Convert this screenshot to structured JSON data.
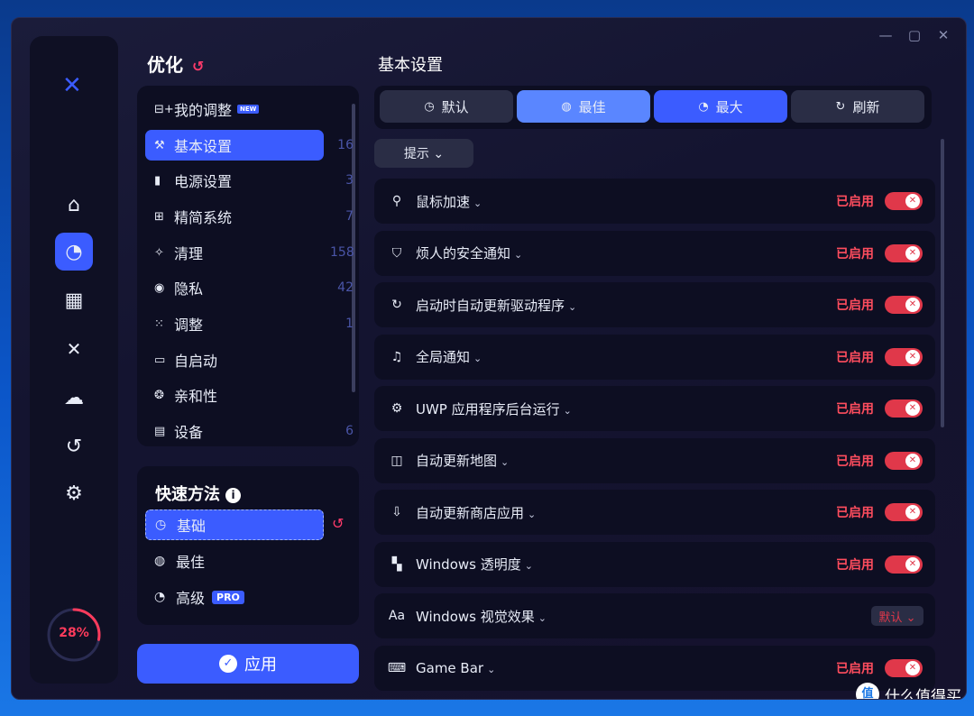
{
  "window_controls": {
    "minimize": "—",
    "maximize": "▢",
    "close": "✕"
  },
  "sidebar": {
    "logo": "✕",
    "nav": [
      {
        "name": "home-icon",
        "glyph": "⌂"
      },
      {
        "name": "speed-gauge-icon",
        "glyph": "◔"
      },
      {
        "name": "apps-grid-icon",
        "glyph": "▦"
      },
      {
        "name": "connections-icon",
        "glyph": "✕"
      },
      {
        "name": "cloud-upload-icon",
        "glyph": "☁"
      },
      {
        "name": "restore-icon",
        "glyph": "↺"
      },
      {
        "name": "settings-gear-icon",
        "glyph": "⚙"
      }
    ],
    "progress_value": 28,
    "progress_text": "28%"
  },
  "left": {
    "title": "优化",
    "reset_glyph": "↺",
    "categories": [
      {
        "icon": "⊟+",
        "label": "我的调整",
        "badge": "NEW",
        "count": ""
      },
      {
        "icon": "⚒",
        "label": "基本设置",
        "badge": "",
        "count": "16"
      },
      {
        "icon": "▮",
        "label": "电源设置",
        "badge": "",
        "count": "3"
      },
      {
        "icon": "⊞",
        "label": "精简系统",
        "badge": "",
        "count": "7"
      },
      {
        "icon": "✧",
        "label": "清理",
        "badge": "",
        "count": "158"
      },
      {
        "icon": "◉",
        "label": "隐私",
        "badge": "",
        "count": "42"
      },
      {
        "icon": "⁙",
        "label": "调整",
        "badge": "",
        "count": "1"
      },
      {
        "icon": "▭",
        "label": "自启动",
        "badge": "",
        "count": ""
      },
      {
        "icon": "❂",
        "label": "亲和性",
        "badge": "",
        "count": ""
      },
      {
        "icon": "▤",
        "label": "设备",
        "badge": "",
        "count": "6"
      }
    ],
    "quick": {
      "title": "快速方法",
      "info_glyph": "i",
      "items": [
        {
          "icon": "◷",
          "label": "基础",
          "badge": ""
        },
        {
          "icon": "◍",
          "label": "最佳",
          "badge": ""
        },
        {
          "icon": "◔",
          "label": "高级",
          "badge": "PRO"
        }
      ],
      "reset_glyph": "↺"
    },
    "apply_label": "应用",
    "apply_glyph": "✓"
  },
  "main": {
    "title": "基本设置",
    "presets": [
      {
        "icon": "◷",
        "label": "默认"
      },
      {
        "icon": "◍",
        "label": "最佳"
      },
      {
        "icon": "◔",
        "label": "最大"
      },
      {
        "icon": "↻",
        "label": "刷新"
      }
    ],
    "tip_label": "提示 ⌄",
    "rows": [
      {
        "icon": "⚲",
        "label": "鼠标加速",
        "status": "已启用",
        "toggle": "✕"
      },
      {
        "icon": "⛉",
        "label": "烦人的安全通知",
        "status": "已启用",
        "toggle": "✕"
      },
      {
        "icon": "↻",
        "label": "启动时自动更新驱动程序",
        "status": "已启用",
        "toggle": "✕"
      },
      {
        "icon": "♫",
        "label": "全局通知",
        "status": "已启用",
        "toggle": "✕"
      },
      {
        "icon": "⚙",
        "label": "UWP 应用程序后台运行",
        "status": "已启用",
        "toggle": "✕"
      },
      {
        "icon": "◫",
        "label": "自动更新地图",
        "status": "已启用",
        "toggle": "✕"
      },
      {
        "icon": "⇩",
        "label": "自动更新商店应用",
        "status": "已启用",
        "toggle": "✕"
      },
      {
        "icon": "▚",
        "label": "Windows 透明度",
        "status": "已启用",
        "toggle": "✕"
      },
      {
        "icon": "Aa",
        "label": "Windows 视觉效果",
        "status": "",
        "select": "默认 ⌄"
      },
      {
        "icon": "⌨",
        "label": "Game Bar",
        "status": "已启用",
        "toggle": "✕"
      }
    ],
    "chevron": "⌄"
  },
  "watermark": {
    "icon": "值",
    "text": "什么值得买"
  },
  "colors": {
    "accent": "#3b5cff",
    "danger": "#e0384a",
    "panel": "#0d0e22"
  }
}
